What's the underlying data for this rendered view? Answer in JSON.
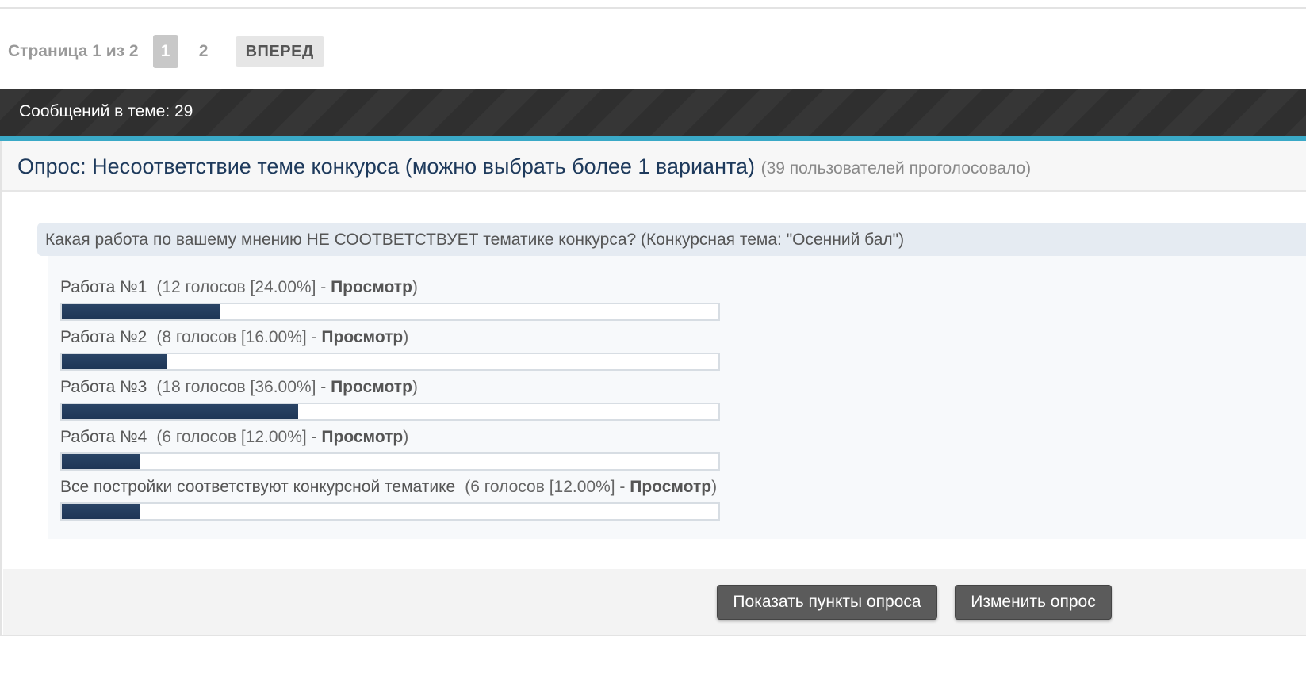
{
  "pagination": {
    "info": "Страница 1 из 2",
    "pages": [
      "1",
      "2"
    ],
    "current": "1",
    "next_label": "ВПЕРЕД"
  },
  "thread": {
    "messages_label": "Сообщений в теме: 29"
  },
  "poll": {
    "title": "Опрос: Несоответствие теме конкурса (можно выбрать более 1 варианта)",
    "voters": "(39 пользователей проголосовало)",
    "question": "Какая работа по вашему мнению НЕ СООТВЕТСТВУЕТ тематике конкурса? (Конкурсная тема: \"Осенний бал\")",
    "options": [
      {
        "label": "Работа №1",
        "stats": "(12 голосов [24.00%] - ",
        "view": "Просмотр",
        "close": ")",
        "percent": 24
      },
      {
        "label": "Работа №2",
        "stats": "(8 голосов [16.00%] - ",
        "view": "Просмотр",
        "close": ")",
        "percent": 16
      },
      {
        "label": "Работа №3",
        "stats": "(18 голосов [36.00%] - ",
        "view": "Просмотр",
        "close": ")",
        "percent": 36
      },
      {
        "label": "Работа №4",
        "stats": "(6 голосов [12.00%] - ",
        "view": "Просмотр",
        "close": ")",
        "percent": 12
      },
      {
        "label": "Все постройки соответствуют конкурсной тематике",
        "stats": "(6 голосов [12.00%] - ",
        "view": "Просмотр",
        "close": ")",
        "percent": 12
      }
    ],
    "buttons": {
      "show_options": "Показать пункты опроса",
      "edit_poll": "Изменить опрос"
    },
    "bar_color": "#1e3656"
  }
}
